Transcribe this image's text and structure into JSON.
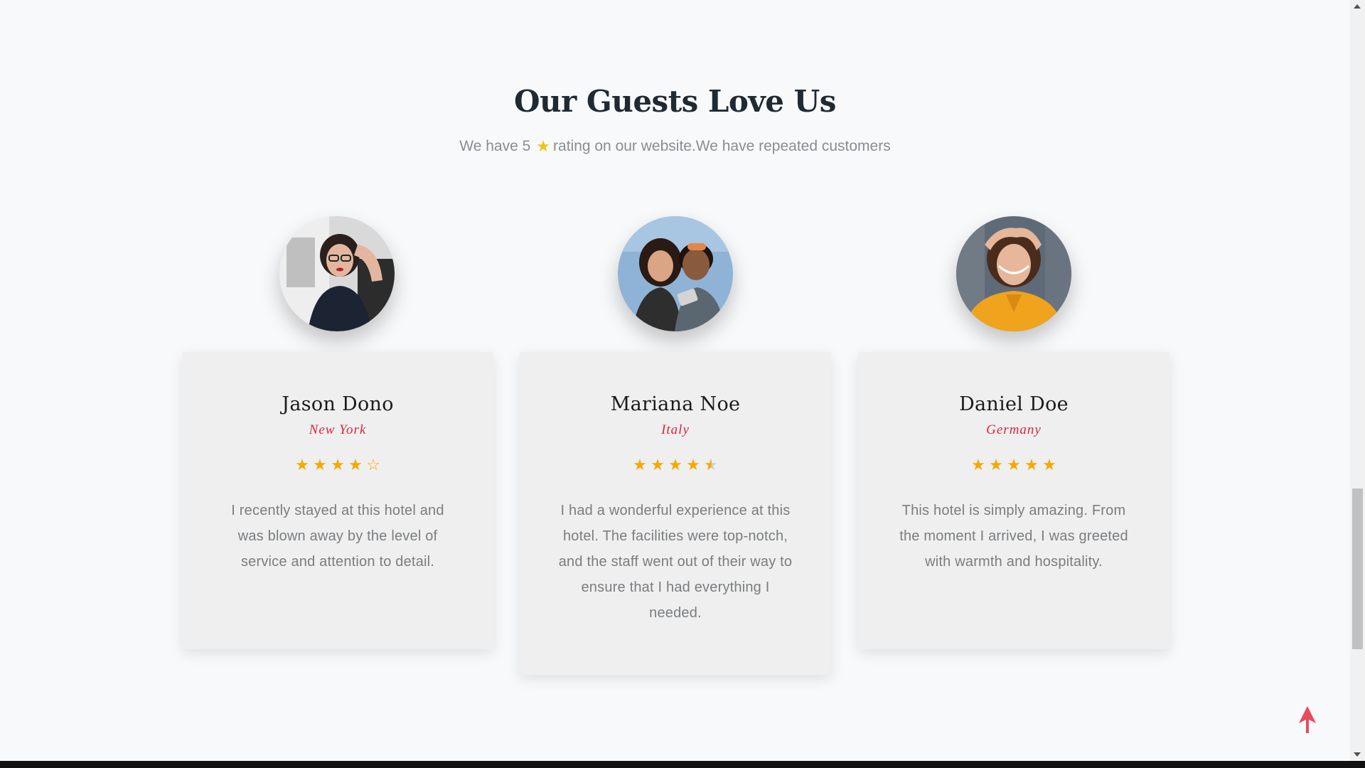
{
  "section": {
    "title": "Our Guests Love Us",
    "subtitle_before": "We have 5",
    "subtitle_after": "rating on our website.We have repeated customers"
  },
  "testimonials": [
    {
      "name": "Jason Dono",
      "location": "New York",
      "rating": 4,
      "text": "I recently stayed at this hotel and was blown away by the level of service and attention to detail."
    },
    {
      "name": "Mariana Noe",
      "location": "Italy",
      "rating": 4.5,
      "text": "I had a wonderful experience at this hotel. The facilities were top-notch, and the staff went out of their way to ensure that I had everything I needed."
    },
    {
      "name": "Daniel Doe",
      "location": "Germany",
      "rating": 5,
      "text": "This hotel is simply amazing. From the moment I arrived, I was greeted with warmth and hospitality."
    }
  ],
  "colors": {
    "accent": "#d7263d",
    "star": "#f5a800",
    "subtitle_star": "#f3c318",
    "back_to_top": "#e84a5f"
  },
  "icons": {
    "back_to_top": "arrow-up-icon",
    "rating": "star-icon"
  }
}
